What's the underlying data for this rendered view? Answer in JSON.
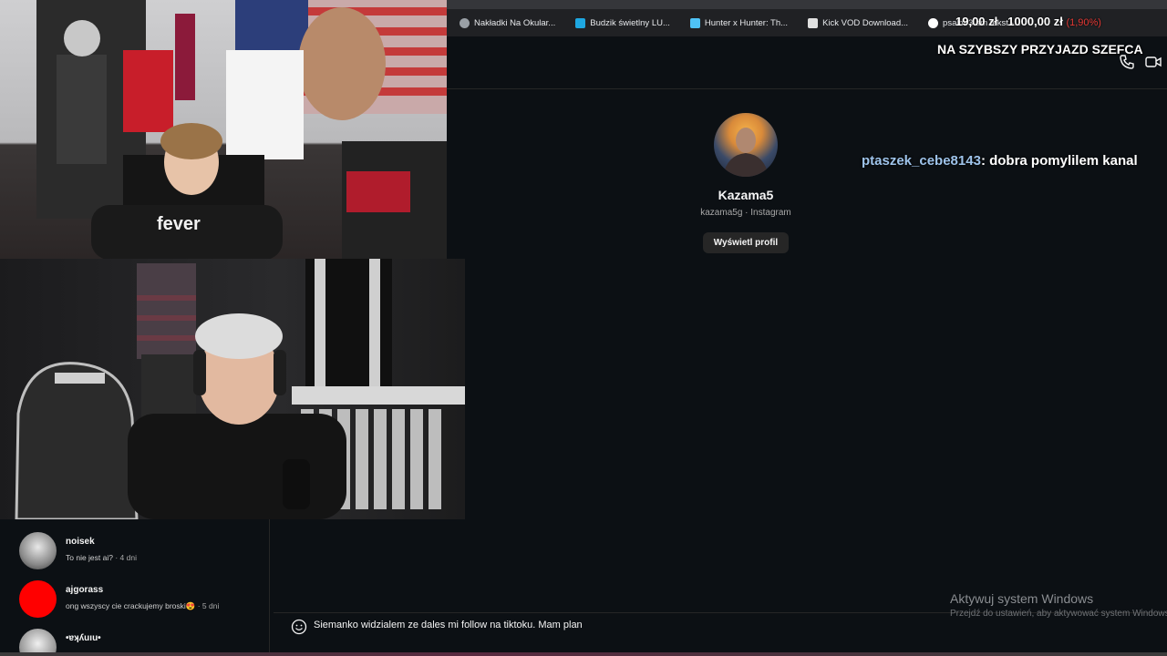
{
  "browser": {
    "bookmarks": [
      {
        "label": "Nakładki Na Okular...",
        "icon": "globe-icon",
        "color": "#9aa0a6"
      },
      {
        "label": "Budzik świetlny LU...",
        "icon": "store-icon",
        "color": "#1ea7e1"
      },
      {
        "label": "Hunter x Hunter: Th...",
        "icon": "anime-icon",
        "color": "#4fc3f7"
      },
      {
        "label": "Kick VOD Download...",
        "icon": "download-icon",
        "color": "#e0e0e0"
      },
      {
        "label": "psalm 3 am tekst -...",
        "icon": "google-icon",
        "color": "#ffffff"
      }
    ]
  },
  "overlay": {
    "price_current": "19,00 zł",
    "price_goal": "1000,00 zł",
    "price_percent": "(1,90%)",
    "alert_text": "NA SZYBSZY PRZYJAZD SZEFCA",
    "chat_user": "ptaszek_cebe8143",
    "chat_message": ": dobra pomylilem kanal"
  },
  "profile": {
    "name": "Kazama5",
    "subtitle": "kazama5g · Instagram",
    "button_label": "Wyświetl profil"
  },
  "comments": [
    {
      "user": "noisek",
      "text": "To nie jest ai?",
      "meta": " · 4 dni",
      "avatar_color": "#cfcfcf"
    },
    {
      "user": "ajgorass",
      "text": "ong wszyscy cie crackujemy broski😍",
      "meta": " · 5 dni",
      "avatar_color": "#ff0000"
    },
    {
      "user": "•ɐʞʎuıu•",
      "text": "",
      "meta": "",
      "avatar_color": "#e6e6e6"
    }
  ],
  "composer": {
    "message": "Siemanko widzialem ze dales mi follow na tiktoku. Mam plan"
  },
  "windows": {
    "title": "Aktywuj system Windows",
    "subtitle": "Przejdź do ustawień, aby aktywować system Windows."
  }
}
